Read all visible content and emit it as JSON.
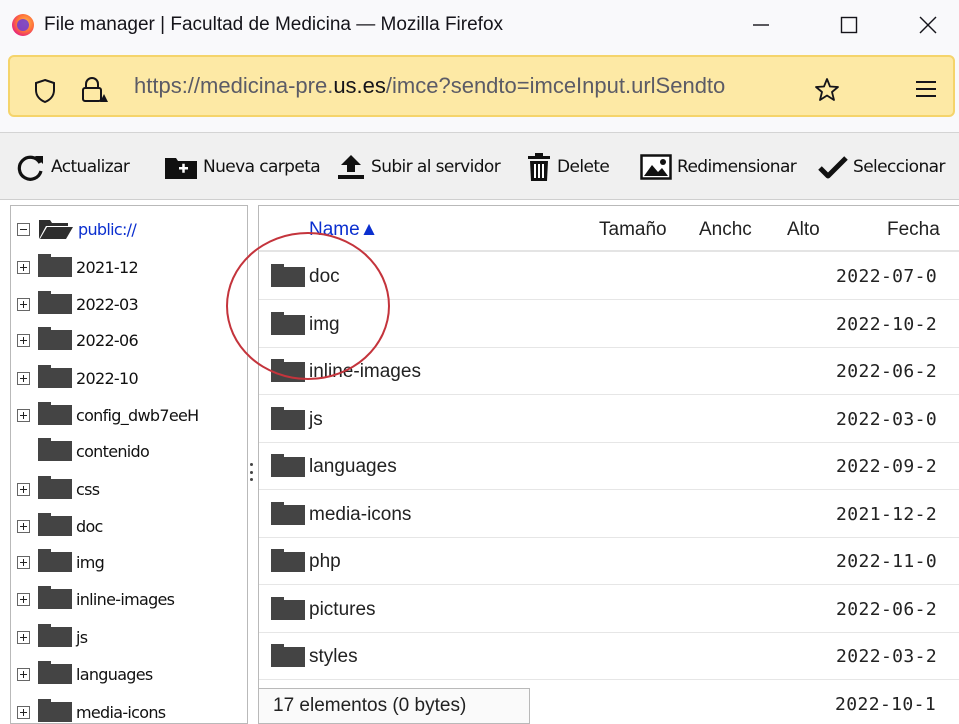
{
  "window": {
    "title": "File manager | Facultad de Medicina — Mozilla Firefox"
  },
  "urlbar": {
    "url_prefix": "https://medicina-pre.",
    "url_domain": "us.es",
    "url_suffix": "/imce?sendto=imceInput.urlSendto"
  },
  "toolbar": {
    "refresh": "Actualizar",
    "new_folder": "Nueva carpeta",
    "upload": "Subir al servidor",
    "delete": "Delete",
    "resize": "Redimensionar",
    "select": "Seleccionar"
  },
  "tree": {
    "root": "public://",
    "items": [
      {
        "label": "2021-12",
        "expandable": true
      },
      {
        "label": "2022-03",
        "expandable": true
      },
      {
        "label": "2022-06",
        "expandable": true
      },
      {
        "label": "2022-10",
        "expandable": true
      },
      {
        "label": "config_dwb7eeH",
        "expandable": true
      },
      {
        "label": "contenido",
        "expandable": false
      },
      {
        "label": "css",
        "expandable": true
      },
      {
        "label": "doc",
        "expandable": true
      },
      {
        "label": "img",
        "expandable": true
      },
      {
        "label": "inline-images",
        "expandable": true
      },
      {
        "label": "js",
        "expandable": true
      },
      {
        "label": "languages",
        "expandable": true
      },
      {
        "label": "media-icons",
        "expandable": true
      }
    ]
  },
  "list": {
    "columns": {
      "name": "Name▲",
      "size": "Tamaño",
      "width": "Anchc",
      "height": "Alto",
      "date": "Fecha"
    },
    "rows": [
      {
        "name": "doc",
        "date": "2022-07-0"
      },
      {
        "name": "img",
        "date": "2022-10-2"
      },
      {
        "name": "inline-images",
        "date": "2022-06-2"
      },
      {
        "name": "js",
        "date": "2022-03-0"
      },
      {
        "name": "languages",
        "date": "2022-09-2"
      },
      {
        "name": "media-icons",
        "date": "2021-12-2"
      },
      {
        "name": "php",
        "date": "2022-11-0"
      },
      {
        "name": "pictures",
        "date": "2022-06-2"
      },
      {
        "name": "styles",
        "date": "2022-03-2"
      }
    ],
    "partial_row_date": "2022-10-1"
  },
  "status": {
    "summary": "17 elementos (0 bytes)"
  },
  "colors": {
    "urlbar_bg": "#fde9a5",
    "accent_link": "#0b2fcf",
    "annotation_circle": "#c4343c"
  }
}
